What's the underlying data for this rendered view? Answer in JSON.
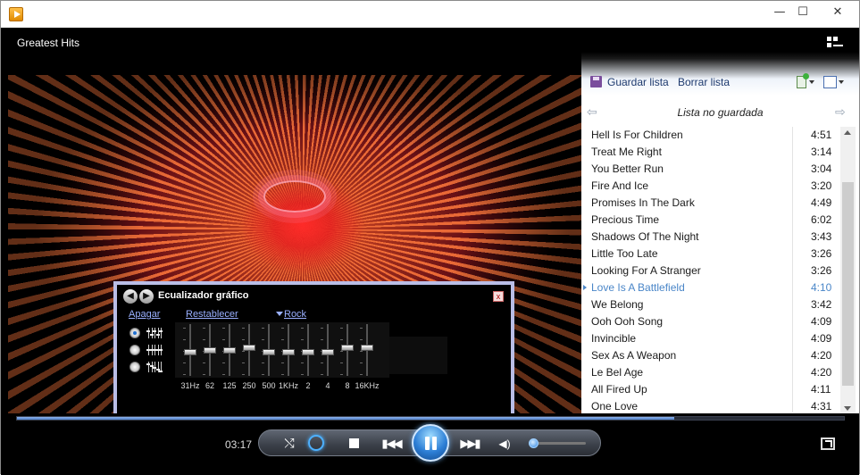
{
  "window": {
    "minimize_glyph": "—",
    "maximize_glyph": "☐",
    "close_glyph": "✕"
  },
  "video": {
    "title": "Greatest Hits"
  },
  "equalizer": {
    "title": "Ecualizador gráfico",
    "off_label": "Apagar",
    "reset_label": "Restablecer",
    "preset_label": "Rock",
    "selected_mode": 0,
    "bands": [
      {
        "label": "31Hz",
        "level": 0.45
      },
      {
        "label": "62",
        "level": 0.5
      },
      {
        "label": "125",
        "level": 0.5
      },
      {
        "label": "250",
        "level": 0.55
      },
      {
        "label": "500",
        "level": 0.45
      },
      {
        "label": "1KHz",
        "level": 0.45
      },
      {
        "label": "2",
        "level": 0.45
      },
      {
        "label": "4",
        "level": 0.45
      },
      {
        "label": "8",
        "level": 0.55
      },
      {
        "label": "16KHz",
        "level": 0.55
      }
    ]
  },
  "playlist": {
    "save_label": "Guardar lista",
    "clear_label": "Borrar lista",
    "title": "Lista no guardada",
    "tracks": [
      {
        "title": "Hell Is For Children",
        "time": "4:51"
      },
      {
        "title": "Treat Me Right",
        "time": "3:14"
      },
      {
        "title": "You Better Run",
        "time": "3:04"
      },
      {
        "title": "Fire And Ice",
        "time": "3:20"
      },
      {
        "title": "Promises In The Dark",
        "time": "4:49"
      },
      {
        "title": "Precious Time",
        "time": "6:02"
      },
      {
        "title": "Shadows Of The Night",
        "time": "3:43"
      },
      {
        "title": "Little Too Late",
        "time": "3:26"
      },
      {
        "title": "Looking For A Stranger",
        "time": "3:26"
      },
      {
        "title": "Love Is A Battlefield",
        "time": "4:10",
        "active": true
      },
      {
        "title": "We Belong",
        "time": "3:42"
      },
      {
        "title": "Ooh Ooh Song",
        "time": "4:09"
      },
      {
        "title": "Invincible",
        "time": "4:09"
      },
      {
        "title": "Sex As A Weapon",
        "time": "4:20"
      },
      {
        "title": "Le Bel Age",
        "time": "4:20"
      },
      {
        "title": "All Fired Up",
        "time": "4:11"
      },
      {
        "title": "One Love",
        "time": "4:31"
      }
    ]
  },
  "player": {
    "current_time": "03:17",
    "seek_fraction": 0.795,
    "volume_fraction": 0.1,
    "accent_color": "#4da0ff"
  }
}
